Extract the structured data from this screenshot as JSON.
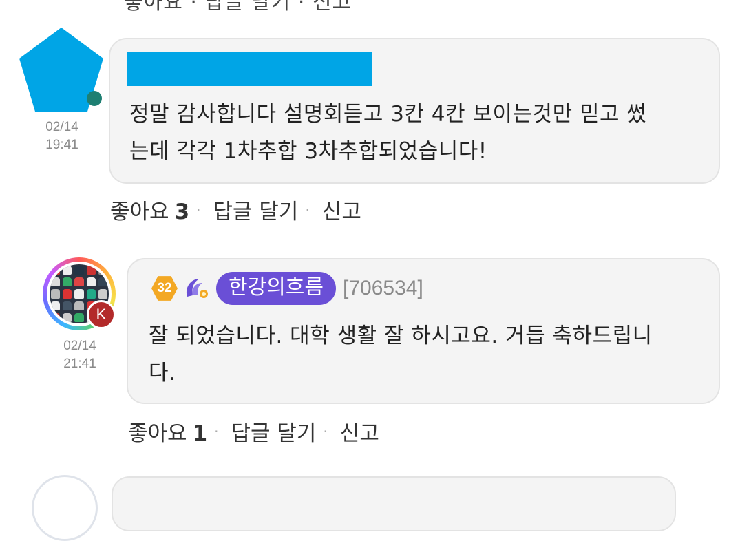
{
  "top_partial_text": "좋아요 · 답글 달기 · 신고",
  "comments": [
    {
      "time_date": "02/14",
      "time_clock": "19:41",
      "text_line1": "정말 감사합니다 설명회듣고 3칸 4칸 보이는것만 믿고 썼",
      "text_line2": "는데 각각 1차추합 3차추합되었습니다!",
      "like_label": "좋아요",
      "like_count": "3",
      "reply_label": "답글 달기",
      "report_label": "신고",
      "colors": {
        "avatar": "#00a5e6",
        "redaction": "#00a5e6"
      }
    },
    {
      "time_date": "02/14",
      "time_clock": "21:41",
      "level": "32",
      "rank_icon": "rank-emblem-icon",
      "nickname": "한강의흐름",
      "user_id": "[706534]",
      "text_line1": "잘 되었습니다. 대학 생활 잘 하시고요. 거듭 축하드립니",
      "text_line2": "다.",
      "like_label": "좋아요",
      "like_count": "1",
      "reply_label": "답글 달기",
      "report_label": "신고",
      "avatar_badge": "K",
      "colors": {
        "level": "#f3a824",
        "nickname_pill": "#6a4fd6",
        "badge": "#b32a2a"
      }
    }
  ]
}
